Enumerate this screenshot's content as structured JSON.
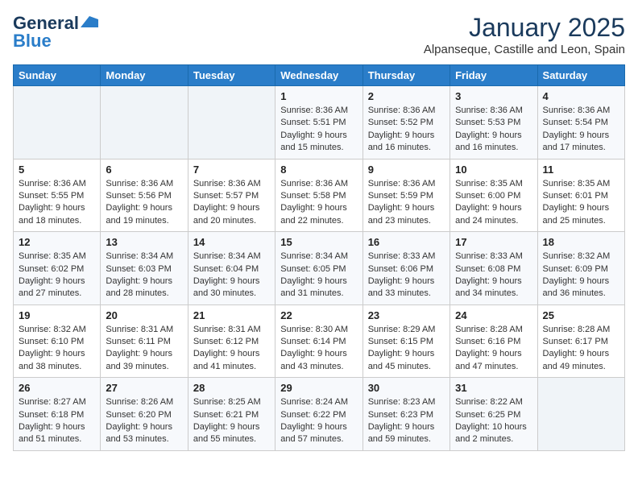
{
  "logo": {
    "line1": "General",
    "line2": "Blue"
  },
  "title": "January 2025",
  "subtitle": "Alpanseque, Castille and Leon, Spain",
  "weekdays": [
    "Sunday",
    "Monday",
    "Tuesday",
    "Wednesday",
    "Thursday",
    "Friday",
    "Saturday"
  ],
  "weeks": [
    [
      {
        "day": "",
        "info": ""
      },
      {
        "day": "",
        "info": ""
      },
      {
        "day": "",
        "info": ""
      },
      {
        "day": "1",
        "info": "Sunrise: 8:36 AM\nSunset: 5:51 PM\nDaylight: 9 hours\nand 15 minutes."
      },
      {
        "day": "2",
        "info": "Sunrise: 8:36 AM\nSunset: 5:52 PM\nDaylight: 9 hours\nand 16 minutes."
      },
      {
        "day": "3",
        "info": "Sunrise: 8:36 AM\nSunset: 5:53 PM\nDaylight: 9 hours\nand 16 minutes."
      },
      {
        "day": "4",
        "info": "Sunrise: 8:36 AM\nSunset: 5:54 PM\nDaylight: 9 hours\nand 17 minutes."
      }
    ],
    [
      {
        "day": "5",
        "info": "Sunrise: 8:36 AM\nSunset: 5:55 PM\nDaylight: 9 hours\nand 18 minutes."
      },
      {
        "day": "6",
        "info": "Sunrise: 8:36 AM\nSunset: 5:56 PM\nDaylight: 9 hours\nand 19 minutes."
      },
      {
        "day": "7",
        "info": "Sunrise: 8:36 AM\nSunset: 5:57 PM\nDaylight: 9 hours\nand 20 minutes."
      },
      {
        "day": "8",
        "info": "Sunrise: 8:36 AM\nSunset: 5:58 PM\nDaylight: 9 hours\nand 22 minutes."
      },
      {
        "day": "9",
        "info": "Sunrise: 8:36 AM\nSunset: 5:59 PM\nDaylight: 9 hours\nand 23 minutes."
      },
      {
        "day": "10",
        "info": "Sunrise: 8:35 AM\nSunset: 6:00 PM\nDaylight: 9 hours\nand 24 minutes."
      },
      {
        "day": "11",
        "info": "Sunrise: 8:35 AM\nSunset: 6:01 PM\nDaylight: 9 hours\nand 25 minutes."
      }
    ],
    [
      {
        "day": "12",
        "info": "Sunrise: 8:35 AM\nSunset: 6:02 PM\nDaylight: 9 hours\nand 27 minutes."
      },
      {
        "day": "13",
        "info": "Sunrise: 8:34 AM\nSunset: 6:03 PM\nDaylight: 9 hours\nand 28 minutes."
      },
      {
        "day": "14",
        "info": "Sunrise: 8:34 AM\nSunset: 6:04 PM\nDaylight: 9 hours\nand 30 minutes."
      },
      {
        "day": "15",
        "info": "Sunrise: 8:34 AM\nSunset: 6:05 PM\nDaylight: 9 hours\nand 31 minutes."
      },
      {
        "day": "16",
        "info": "Sunrise: 8:33 AM\nSunset: 6:06 PM\nDaylight: 9 hours\nand 33 minutes."
      },
      {
        "day": "17",
        "info": "Sunrise: 8:33 AM\nSunset: 6:08 PM\nDaylight: 9 hours\nand 34 minutes."
      },
      {
        "day": "18",
        "info": "Sunrise: 8:32 AM\nSunset: 6:09 PM\nDaylight: 9 hours\nand 36 minutes."
      }
    ],
    [
      {
        "day": "19",
        "info": "Sunrise: 8:32 AM\nSunset: 6:10 PM\nDaylight: 9 hours\nand 38 minutes."
      },
      {
        "day": "20",
        "info": "Sunrise: 8:31 AM\nSunset: 6:11 PM\nDaylight: 9 hours\nand 39 minutes."
      },
      {
        "day": "21",
        "info": "Sunrise: 8:31 AM\nSunset: 6:12 PM\nDaylight: 9 hours\nand 41 minutes."
      },
      {
        "day": "22",
        "info": "Sunrise: 8:30 AM\nSunset: 6:14 PM\nDaylight: 9 hours\nand 43 minutes."
      },
      {
        "day": "23",
        "info": "Sunrise: 8:29 AM\nSunset: 6:15 PM\nDaylight: 9 hours\nand 45 minutes."
      },
      {
        "day": "24",
        "info": "Sunrise: 8:28 AM\nSunset: 6:16 PM\nDaylight: 9 hours\nand 47 minutes."
      },
      {
        "day": "25",
        "info": "Sunrise: 8:28 AM\nSunset: 6:17 PM\nDaylight: 9 hours\nand 49 minutes."
      }
    ],
    [
      {
        "day": "26",
        "info": "Sunrise: 8:27 AM\nSunset: 6:18 PM\nDaylight: 9 hours\nand 51 minutes."
      },
      {
        "day": "27",
        "info": "Sunrise: 8:26 AM\nSunset: 6:20 PM\nDaylight: 9 hours\nand 53 minutes."
      },
      {
        "day": "28",
        "info": "Sunrise: 8:25 AM\nSunset: 6:21 PM\nDaylight: 9 hours\nand 55 minutes."
      },
      {
        "day": "29",
        "info": "Sunrise: 8:24 AM\nSunset: 6:22 PM\nDaylight: 9 hours\nand 57 minutes."
      },
      {
        "day": "30",
        "info": "Sunrise: 8:23 AM\nSunset: 6:23 PM\nDaylight: 9 hours\nand 59 minutes."
      },
      {
        "day": "31",
        "info": "Sunrise: 8:22 AM\nSunset: 6:25 PM\nDaylight: 10 hours\nand 2 minutes."
      },
      {
        "day": "",
        "info": ""
      }
    ]
  ]
}
